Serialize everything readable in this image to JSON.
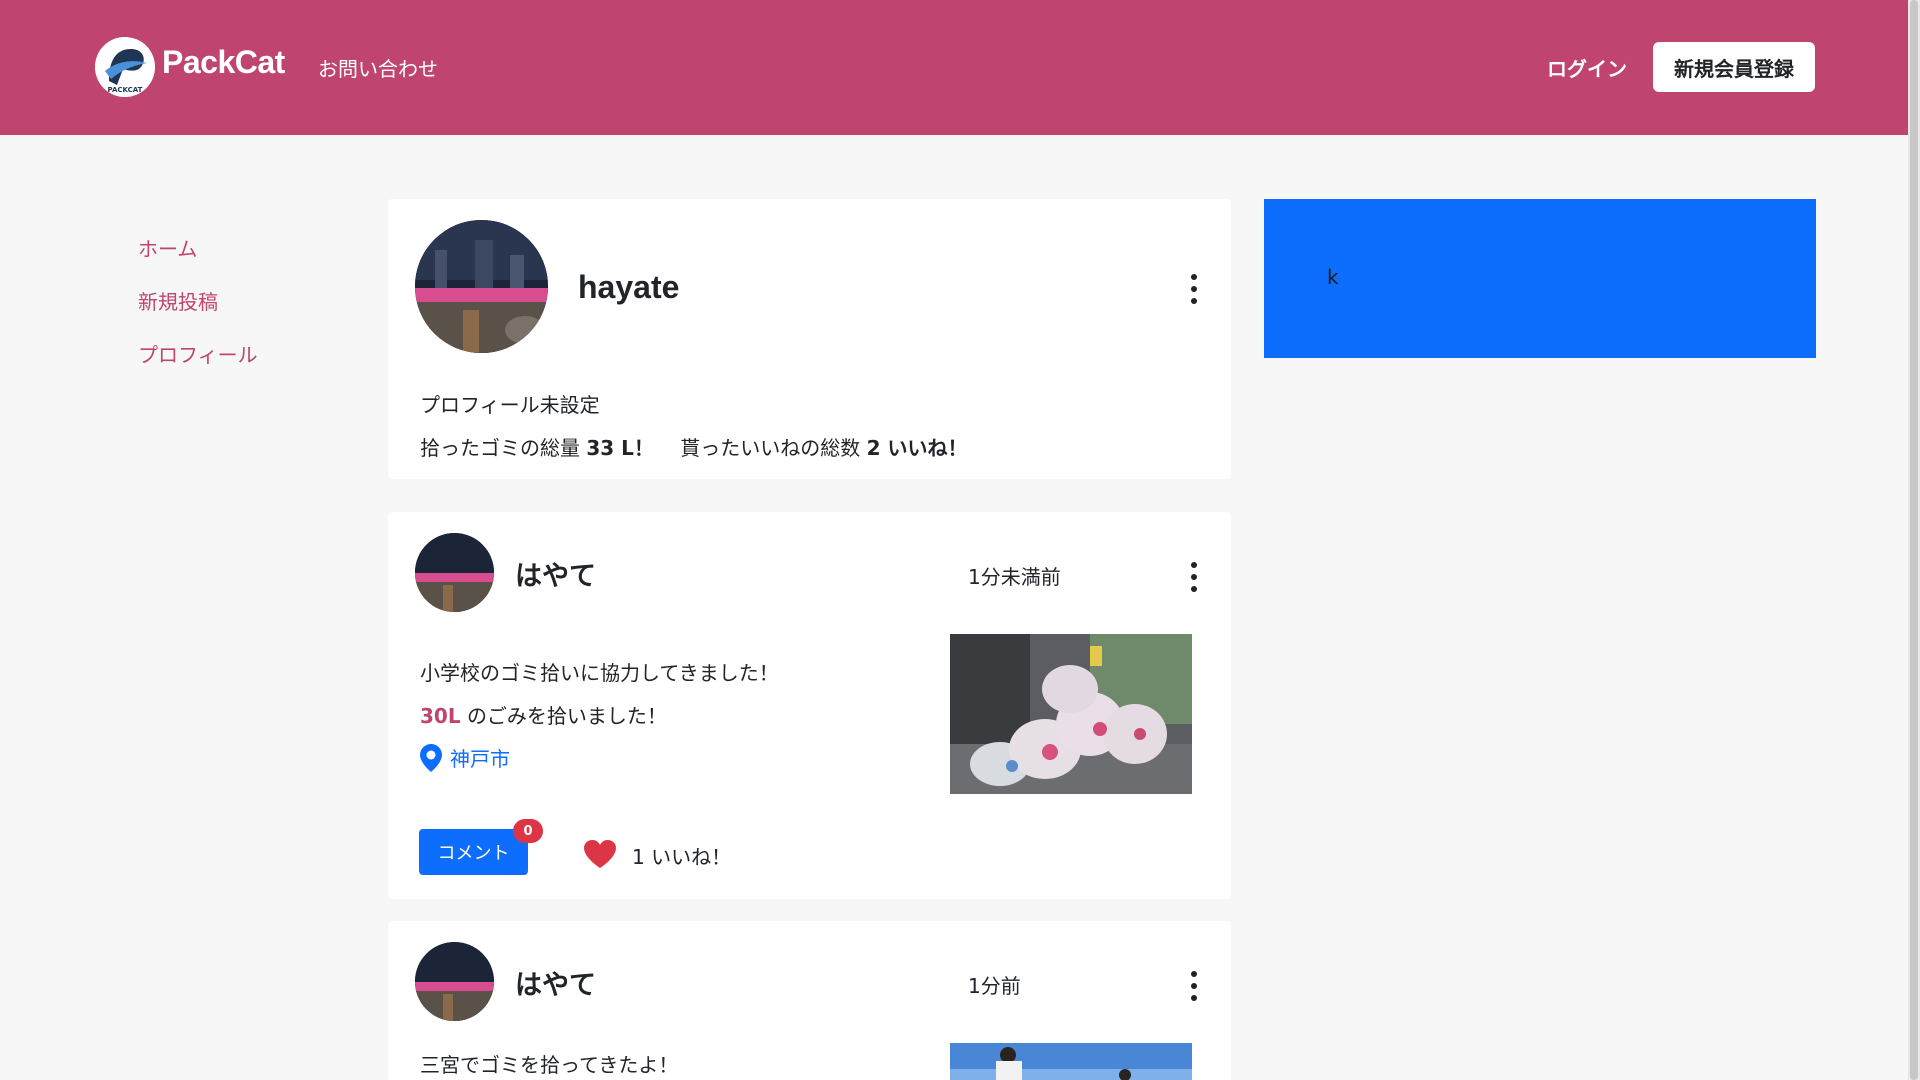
{
  "colors": {
    "brand": "#bf4570",
    "primary": "#0d6efd",
    "danger": "#dc3545",
    "background": "#f7f7f7"
  },
  "navbar": {
    "brand": "PackCat",
    "logo_text": "PACKCAT",
    "contact": "お問い合わせ",
    "login": "ログイン",
    "signup": "新規会員登録"
  },
  "sidebar": {
    "items": [
      {
        "label": "ホーム"
      },
      {
        "label": "新規投稿"
      },
      {
        "label": "プロフィール"
      }
    ]
  },
  "profile": {
    "username": "hayate",
    "bio": "プロフィール未設定",
    "trash_prefix": "拾ったゴミの総量",
    "trash_total": "33 L！",
    "likes_prefix": "貰ったいいねの総数",
    "likes_total": "2 いいね！"
  },
  "posts": [
    {
      "user": "はやて",
      "time": "1分未満前",
      "text": "小学校のゴミ拾いに協力してきました！",
      "volume": "30L",
      "volume_suffix": "のごみを拾いました！",
      "location": "神戸市",
      "comment_label": "コメント",
      "comment_count": "0",
      "likes": "1 いいね！"
    },
    {
      "user": "はやて",
      "time": "1分前",
      "text": "三宮でゴミを拾ってきたよ！"
    }
  ],
  "ad": {
    "text": "k"
  },
  "icons": [
    "more-vertical-icon",
    "location-pin-icon",
    "heart-icon",
    "packcat-logo-icon"
  ]
}
